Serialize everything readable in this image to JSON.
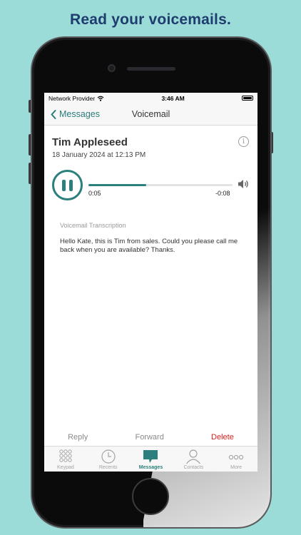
{
  "headline": "Read your voicemails.",
  "status_bar": {
    "carrier": "Network Provider",
    "time": "3:46 AM"
  },
  "nav": {
    "back_label": "Messages",
    "title": "Voicemail"
  },
  "voicemail": {
    "caller": "Tim Appleseed",
    "date": "18 January 2024 at 12:13 PM",
    "elapsed": "0:05",
    "remaining": "-0:08",
    "progress_fraction": 0.4,
    "transcription_label": "Voicemail Transcription",
    "transcription_text": "Hello Kate, this is Tim from sales. Could you please call me back when you are available? Thanks."
  },
  "actions": {
    "reply": "Reply",
    "forward": "Forward",
    "delete": "Delete"
  },
  "tabs": [
    {
      "label": "Keypad",
      "icon": "keypad-icon"
    },
    {
      "label": "Recents",
      "icon": "clock-icon"
    },
    {
      "label": "Messages",
      "icon": "messages-icon",
      "active": true
    },
    {
      "label": "Contacts",
      "icon": "contacts-icon"
    },
    {
      "label": "More",
      "icon": "more-icon"
    }
  ],
  "colors": {
    "accent": "#2b7f7c",
    "delete": "#d81f1f",
    "background": "#9bdcd8",
    "headline": "#1f3c6e"
  }
}
